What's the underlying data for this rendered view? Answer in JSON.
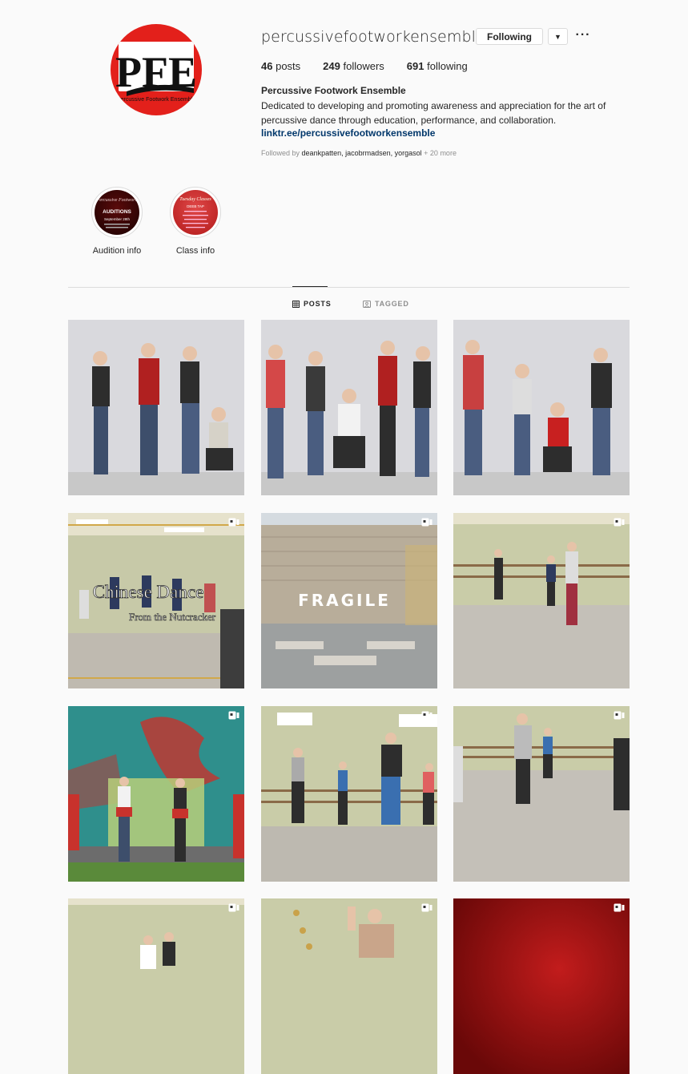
{
  "profile": {
    "username": "percussivefootworkensemble",
    "follow_label": "Following",
    "dropdown_icon": "chevron-down-icon",
    "more_icon": "ellipsis-icon",
    "posts_count": "46",
    "posts_label": "posts",
    "followers_count": "249",
    "followers_label": "followers",
    "following_count": "691",
    "following_label": "following",
    "full_name": "Percussive Footwork Ensemble",
    "bio_line1": "Dedicated to developing and promoting awareness and appreciation for the art of",
    "bio_line2": "percussive dance through education, performance, and collaboration.",
    "link": "linktr.ee/percussivefootworkensemble",
    "followed_by_prefix": "Followed by",
    "followed_by_names": "deankpatten, jacobrmadsen, yorgasol",
    "followed_by_more": "+ 20 more",
    "logo_text": "PFE",
    "logo_subtext": "Percussive Footwork Ensemble",
    "brand_color": "#e3201b"
  },
  "highlights": [
    {
      "label": "Audition info",
      "cover_title": "AUDITIONS",
      "cover_subtitle": "September 28th"
    },
    {
      "label": "Class info",
      "cover_title": "Tuesday Classes",
      "cover_subtitle": "DEEB TAP"
    }
  ],
  "tabs": [
    {
      "label": "POSTS",
      "icon": "grid-icon",
      "active": true
    },
    {
      "label": "TAGGED",
      "icon": "tag-icon",
      "active": false
    }
  ],
  "posts": [
    {
      "type": "photo",
      "scene": "group-photo",
      "overlay_text": ""
    },
    {
      "type": "photo",
      "scene": "group-photo",
      "overlay_text": ""
    },
    {
      "type": "photo",
      "scene": "group-photo",
      "overlay_text": ""
    },
    {
      "type": "video",
      "scene": "studio",
      "overlay_text": "Chinese Dance",
      "overlay_subtext": "From the Nutcracker"
    },
    {
      "type": "video",
      "scene": "wall",
      "overlay_text": "FRAGILE"
    },
    {
      "type": "video",
      "scene": "studio",
      "overlay_text": ""
    },
    {
      "type": "video",
      "scene": "mural",
      "overlay_text": ""
    },
    {
      "type": "video",
      "scene": "studio",
      "overlay_text": ""
    },
    {
      "type": "video",
      "scene": "studio",
      "overlay_text": ""
    },
    {
      "type": "video",
      "scene": "studio",
      "overlay_text": ""
    },
    {
      "type": "video",
      "scene": "studio",
      "overlay_text": ""
    },
    {
      "type": "video",
      "scene": "red",
      "overlay_text": ""
    }
  ]
}
